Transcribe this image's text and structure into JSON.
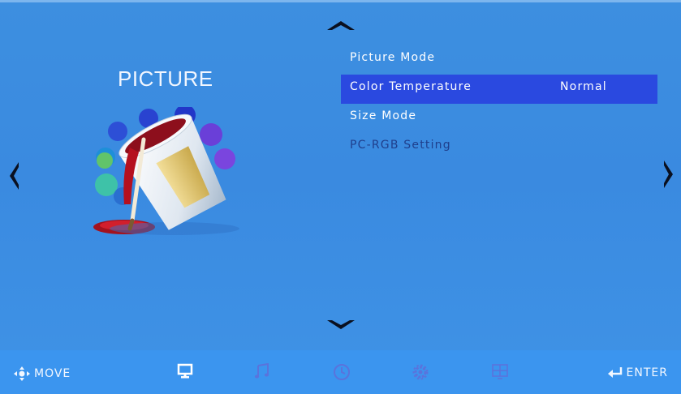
{
  "section": {
    "title": "PICTURE",
    "icon": "paint-bucket-icon"
  },
  "menu": {
    "items": [
      {
        "label": "Picture Mode",
        "value": ""
      },
      {
        "label": "Color Temperature",
        "value": "Normal"
      },
      {
        "label": "Size Mode",
        "value": ""
      },
      {
        "label": "PC-RGB Setting",
        "value": ""
      }
    ],
    "selected_index": 1
  },
  "bottom_bar": {
    "move_label": "MOVE",
    "enter_label": "ENTER",
    "tabs": [
      "monitor-icon",
      "music-note-icon",
      "clock-icon",
      "gear-icon",
      "grid-icon"
    ],
    "active_tab": "monitor-icon"
  },
  "colors": {
    "background": "#3d8fe0",
    "highlight": "#2a49e0",
    "disabled_text": "#1f3f8c"
  }
}
